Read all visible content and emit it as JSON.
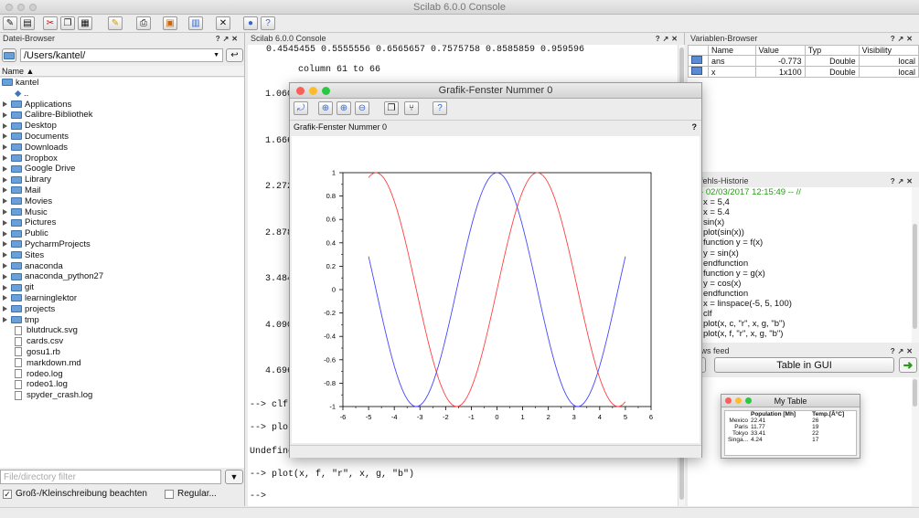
{
  "app": {
    "title": "Scilab 6.0.0 Console"
  },
  "toolbar": {
    "icons": [
      "new-file-icon",
      "open-folder-icon",
      "cut-icon",
      "copy-icon",
      "paste-icon",
      "change-dir-icon",
      "print-icon",
      "applications-icon",
      "scinotes-icon",
      "module-manager-icon",
      "demos-icon",
      "help-icon"
    ]
  },
  "file_browser": {
    "header": "Datei-Browser",
    "path": "/Users/kantel/",
    "col_name": "Name",
    "root": "kantel",
    "up": "..",
    "folders": [
      "Applications",
      "Calibre-Bibliothek",
      "Desktop",
      "Documents",
      "Downloads",
      "Dropbox",
      "Google Drive",
      "Library",
      "Mail",
      "Movies",
      "Music",
      "Pictures",
      "Public",
      "PycharmProjects",
      "Sites",
      "anaconda",
      "anaconda_python27",
      "git",
      "learninglektor",
      "projects",
      "tmp"
    ],
    "files": [
      "blutdruck.svg",
      "cards.csv",
      "gosu1.rb",
      "markdown.md",
      "rodeo.log",
      "rodeo1.log",
      "spyder_crash.log"
    ],
    "filter_placeholder": "File/directory filter",
    "case_label": "Groß-/Kleinschreibung beachten",
    "regex_label": "Regular..."
  },
  "console": {
    "header": "Scilab 6.0.0 Console",
    "top_line": "0.4545455   0.5555556   0.6565657   0.7575758   0.8585859   0.959596",
    "column_line": "column 61 to 66",
    "values": [
      "1.060",
      "1.666",
      "2.272",
      "2.878",
      "3.484",
      "4.090",
      "4.696"
    ],
    "cmd1": "--> clf",
    "cmd2": "--> plot",
    "undef": "Undefine",
    "cmd3": "--> plot(x, f, \"r\", x, g, \"b\")",
    "prompt": "-->"
  },
  "variables": {
    "header": "Variablen-Browser",
    "columns": [
      "Name",
      "Value",
      "Typ",
      "Visibility"
    ],
    "rows": [
      [
        "ans",
        "-0.773",
        "Double",
        "local"
      ],
      [
        "x",
        "1x100",
        "Double",
        "local"
      ]
    ]
  },
  "history": {
    "header": "Befehls-Historie",
    "lines": [
      "// -- 02/03/2017 12:15:49 -- //",
      "x = 5,4",
      "x = 5.4",
      "sin(x)",
      "plot(sin(x))",
      "function y = f(x)",
      "y = sin(x)",
      "endfunction",
      "function y = g(x)",
      "y = cos(x)",
      "endfunction",
      "x = linspace(-5, 5, 100)",
      "clf",
      "plot(x, c, \"r\", x, g, \"b\")",
      "plot(x, f, \"r\", x, g, \"b\")"
    ]
  },
  "news": {
    "header": "News feed",
    "button": "Table in GUI"
  },
  "graphics": {
    "title": "Grafik-Fenster Nummer 0",
    "subtitle": "Grafik-Fenster Nummer 0",
    "help_mark": "?"
  },
  "mytable": {
    "title": "My Table",
    "columns": [
      "",
      "Population [Mh]",
      "Temp.[Â°C]"
    ],
    "rows": [
      [
        "Mexico",
        "22.41",
        "26"
      ],
      [
        "Paris",
        "11.77",
        "19"
      ],
      [
        "Tokyo",
        "33.41",
        "22"
      ],
      [
        "Singa...",
        "4.24",
        "17"
      ]
    ]
  },
  "chart_data": {
    "type": "line",
    "x_ticks": [
      "-6",
      "-5",
      "-4",
      "-3",
      "-2",
      "-1",
      "0",
      "1",
      "2",
      "3",
      "4",
      "5",
      "6"
    ],
    "y_ticks": [
      "1",
      "0.8",
      "0.6",
      "0.4",
      "0.2",
      "0",
      "-0.2",
      "-0.4",
      "-0.6",
      "-0.8",
      "-1"
    ],
    "xlim": [
      -6,
      6
    ],
    "ylim": [
      -1,
      1
    ],
    "x_range": [
      -5,
      5
    ],
    "n_points": 100,
    "series": [
      {
        "function": "sin",
        "color": "#ff4040"
      },
      {
        "function": "cos",
        "color": "#4646ff"
      }
    ],
    "title": "",
    "xlabel": "",
    "ylabel": "",
    "grid": false
  }
}
